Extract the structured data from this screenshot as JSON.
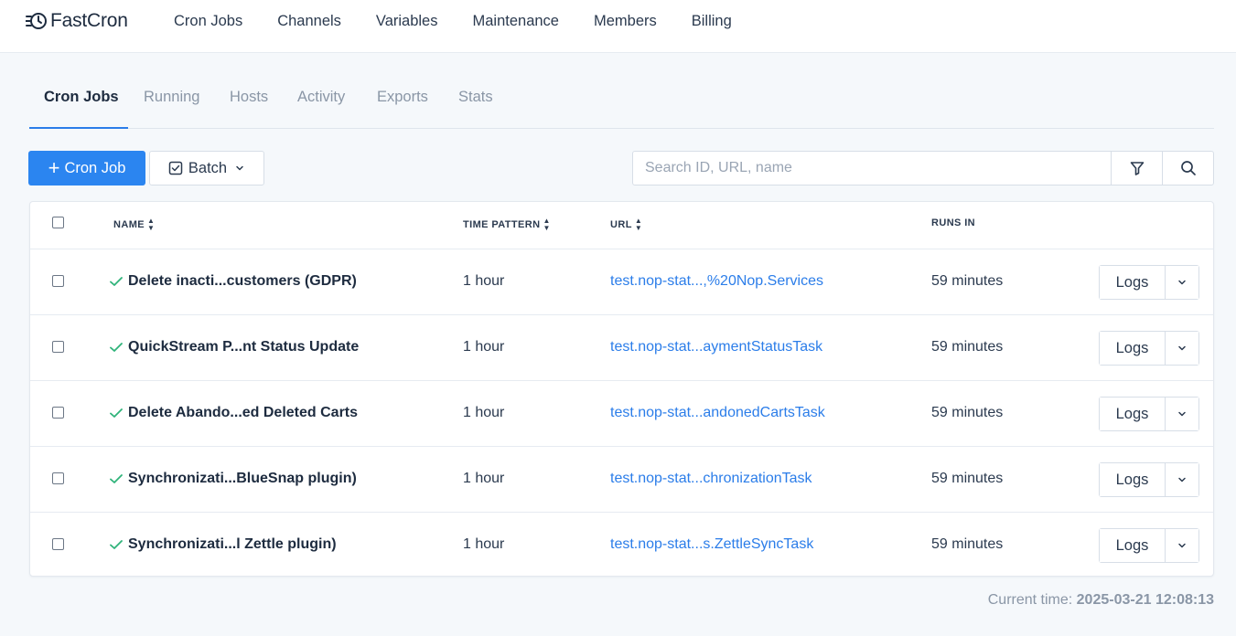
{
  "app": {
    "name": "FastCron"
  },
  "topnav": [
    "Cron Jobs",
    "Channels",
    "Variables",
    "Maintenance",
    "Members",
    "Billing"
  ],
  "tabs": [
    {
      "label": "Cron Jobs",
      "active": true
    },
    {
      "label": "Running",
      "active": false
    },
    {
      "label": "Hosts",
      "active": false
    },
    {
      "label": "Activity",
      "active": false
    },
    {
      "label": "Exports",
      "active": false
    },
    {
      "label": "Stats",
      "active": false
    }
  ],
  "toolbar": {
    "add_label": "Cron Job",
    "batch_label": "Batch",
    "search_placeholder": "Search ID, URL, name"
  },
  "table": {
    "columns": {
      "name": "NAME",
      "pattern": "TIME PATTERN",
      "url": "URL",
      "runs": "RUNS IN"
    },
    "rows": [
      {
        "name": "Delete inacti...customers (GDPR)",
        "pattern": "1 hour",
        "url": "test.nop-stat...,%20Nop.Services",
        "runs": "59 minutes",
        "action": "Logs"
      },
      {
        "name": "QuickStream P...nt Status Update",
        "pattern": "1 hour",
        "url": "test.nop-stat...aymentStatusTask",
        "runs": "59 minutes",
        "action": "Logs"
      },
      {
        "name": "Delete Abando...ed Deleted Carts",
        "pattern": "1 hour",
        "url": "test.nop-stat...andonedCartsTask",
        "runs": "59 minutes",
        "action": "Logs"
      },
      {
        "name": "Synchronizati...BlueSnap plugin)",
        "pattern": "1 hour",
        "url": "test.nop-stat...chronizationTask",
        "runs": "59 minutes",
        "action": "Logs"
      },
      {
        "name": "Synchronizati...l Zettle plugin)",
        "pattern": "1 hour",
        "url": "test.nop-stat...s.ZettleSyncTask",
        "runs": "59 minutes",
        "action": "Logs"
      }
    ]
  },
  "footer": {
    "label": "Current time:",
    "time": "2025-03-21 12:08:13"
  },
  "colors": {
    "accent": "#2b85f0",
    "success": "#2fb37a",
    "link": "#2b7de9"
  },
  "icons": [
    "fastcron-logo-icon",
    "plus-icon",
    "batch-check-icon",
    "chevron-down-icon",
    "filter-icon",
    "search-icon",
    "success-check-icon"
  ]
}
